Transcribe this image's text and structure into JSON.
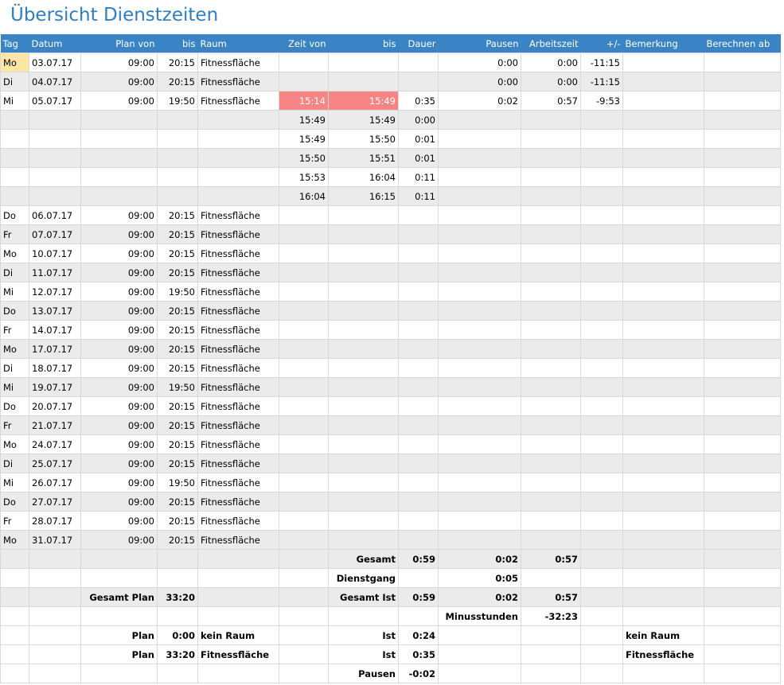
{
  "page": {
    "title": "Übersicht Dienstzeiten"
  },
  "columns": [
    "Tag",
    "Datum",
    "Plan von",
    "bis",
    "Raum",
    "Zeit von",
    "bis",
    "Dauer",
    "Pausen",
    "Arbeitszeit",
    "+/-",
    "Bemerkung",
    "Berechnen ab"
  ],
  "rows": [
    [
      "Mo",
      "03.07.17",
      "09:00",
      "20:15",
      "Fitnessfläche",
      "",
      "",
      "",
      "0:00",
      "0:00",
      "-11:15",
      "",
      ""
    ],
    [
      "Di",
      "04.07.17",
      "09:00",
      "20:15",
      "Fitnessfläche",
      "",
      "",
      "",
      "0:00",
      "0:00",
      "-11:15",
      "",
      ""
    ],
    [
      "Mi",
      "05.07.17",
      "09:00",
      "19:50",
      "Fitnessfläche",
      "15:14",
      "15:49",
      "0:35",
      "0:02",
      "0:57",
      "-9:53",
      "",
      ""
    ],
    [
      "",
      "",
      "",
      "",
      "",
      "15:49",
      "15:49",
      "0:00",
      "",
      "",
      "",
      "",
      ""
    ],
    [
      "",
      "",
      "",
      "",
      "",
      "15:49",
      "15:50",
      "0:01",
      "",
      "",
      "",
      "",
      ""
    ],
    [
      "",
      "",
      "",
      "",
      "",
      "15:50",
      "15:51",
      "0:01",
      "",
      "",
      "",
      "",
      ""
    ],
    [
      "",
      "",
      "",
      "",
      "",
      "15:53",
      "16:04",
      "0:11",
      "",
      "",
      "",
      "",
      ""
    ],
    [
      "",
      "",
      "",
      "",
      "",
      "16:04",
      "16:15",
      "0:11",
      "",
      "",
      "",
      "",
      ""
    ],
    [
      "Do",
      "06.07.17",
      "09:00",
      "20:15",
      "Fitnessfläche",
      "",
      "",
      "",
      "",
      "",
      "",
      "",
      ""
    ],
    [
      "Fr",
      "07.07.17",
      "09:00",
      "20:15",
      "Fitnessfläche",
      "",
      "",
      "",
      "",
      "",
      "",
      "",
      ""
    ],
    [
      "Mo",
      "10.07.17",
      "09:00",
      "20:15",
      "Fitnessfläche",
      "",
      "",
      "",
      "",
      "",
      "",
      "",
      ""
    ],
    [
      "Di",
      "11.07.17",
      "09:00",
      "20:15",
      "Fitnessfläche",
      "",
      "",
      "",
      "",
      "",
      "",
      "",
      ""
    ],
    [
      "Mi",
      "12.07.17",
      "09:00",
      "19:50",
      "Fitnessfläche",
      "",
      "",
      "",
      "",
      "",
      "",
      "",
      ""
    ],
    [
      "Do",
      "13.07.17",
      "09:00",
      "20:15",
      "Fitnessfläche",
      "",
      "",
      "",
      "",
      "",
      "",
      "",
      ""
    ],
    [
      "Fr",
      "14.07.17",
      "09:00",
      "20:15",
      "Fitnessfläche",
      "",
      "",
      "",
      "",
      "",
      "",
      "",
      ""
    ],
    [
      "Mo",
      "17.07.17",
      "09:00",
      "20:15",
      "Fitnessfläche",
      "",
      "",
      "",
      "",
      "",
      "",
      "",
      ""
    ],
    [
      "Di",
      "18.07.17",
      "09:00",
      "20:15",
      "Fitnessfläche",
      "",
      "",
      "",
      "",
      "",
      "",
      "",
      ""
    ],
    [
      "Mi",
      "19.07.17",
      "09:00",
      "19:50",
      "Fitnessfläche",
      "",
      "",
      "",
      "",
      "",
      "",
      "",
      ""
    ],
    [
      "Do",
      "20.07.17",
      "09:00",
      "20:15",
      "Fitnessfläche",
      "",
      "",
      "",
      "",
      "",
      "",
      "",
      ""
    ],
    [
      "Fr",
      "21.07.17",
      "09:00",
      "20:15",
      "Fitnessfläche",
      "",
      "",
      "",
      "",
      "",
      "",
      "",
      ""
    ],
    [
      "Mo",
      "24.07.17",
      "09:00",
      "20:15",
      "Fitnessfläche",
      "",
      "",
      "",
      "",
      "",
      "",
      "",
      ""
    ],
    [
      "Di",
      "25.07.17",
      "09:00",
      "20:15",
      "Fitnessfläche",
      "",
      "",
      "",
      "",
      "",
      "",
      "",
      ""
    ],
    [
      "Mi",
      "26.07.17",
      "09:00",
      "19:50",
      "Fitnessfläche",
      "",
      "",
      "",
      "",
      "",
      "",
      "",
      ""
    ],
    [
      "Do",
      "27.07.17",
      "09:00",
      "20:15",
      "Fitnessfläche",
      "",
      "",
      "",
      "",
      "",
      "",
      "",
      ""
    ],
    [
      "Fr",
      "28.07.17",
      "09:00",
      "20:15",
      "Fitnessfläche",
      "",
      "",
      "",
      "",
      "",
      "",
      "",
      ""
    ],
    [
      "Mo",
      "31.07.17",
      "09:00",
      "20:15",
      "Fitnessfläche",
      "",
      "",
      "",
      "",
      "",
      "",
      "",
      ""
    ]
  ],
  "highlight": {
    "today_color": "#ffe6a6",
    "warn_color": "#f88585",
    "header_color": "#3a84c5",
    "title_color": "#2e7fc2"
  },
  "summary": [
    [
      "",
      "",
      "",
      "",
      "",
      "",
      "Gesamt",
      "0:59",
      "0:02",
      "0:57",
      "",
      "",
      ""
    ],
    [
      "",
      "",
      "",
      "",
      "",
      "",
      "Dienstgang",
      "",
      "0:05",
      "",
      "",
      "",
      ""
    ],
    [
      "",
      "",
      "Gesamt Plan",
      "33:20",
      "",
      "",
      "Gesamt Ist",
      "0:59",
      "0:02",
      "0:57",
      "",
      "",
      ""
    ],
    [
      "",
      "",
      "",
      "",
      "",
      "",
      "",
      "",
      "Minusstunden",
      "-32:23",
      "",
      "",
      ""
    ],
    [
      "",
      "",
      "Plan",
      "0:00",
      "kein Raum",
      "",
      "Ist",
      "0:24",
      "",
      "",
      "",
      "kein Raum",
      ""
    ],
    [
      "",
      "",
      "Plan",
      "33:20",
      "Fitnessfläche",
      "",
      "Ist",
      "0:35",
      "",
      "",
      "",
      "Fitnessfläche",
      ""
    ],
    [
      "",
      "",
      "",
      "",
      "",
      "",
      "Pausen",
      "-0:02",
      "",
      "",
      "",
      "",
      ""
    ]
  ]
}
